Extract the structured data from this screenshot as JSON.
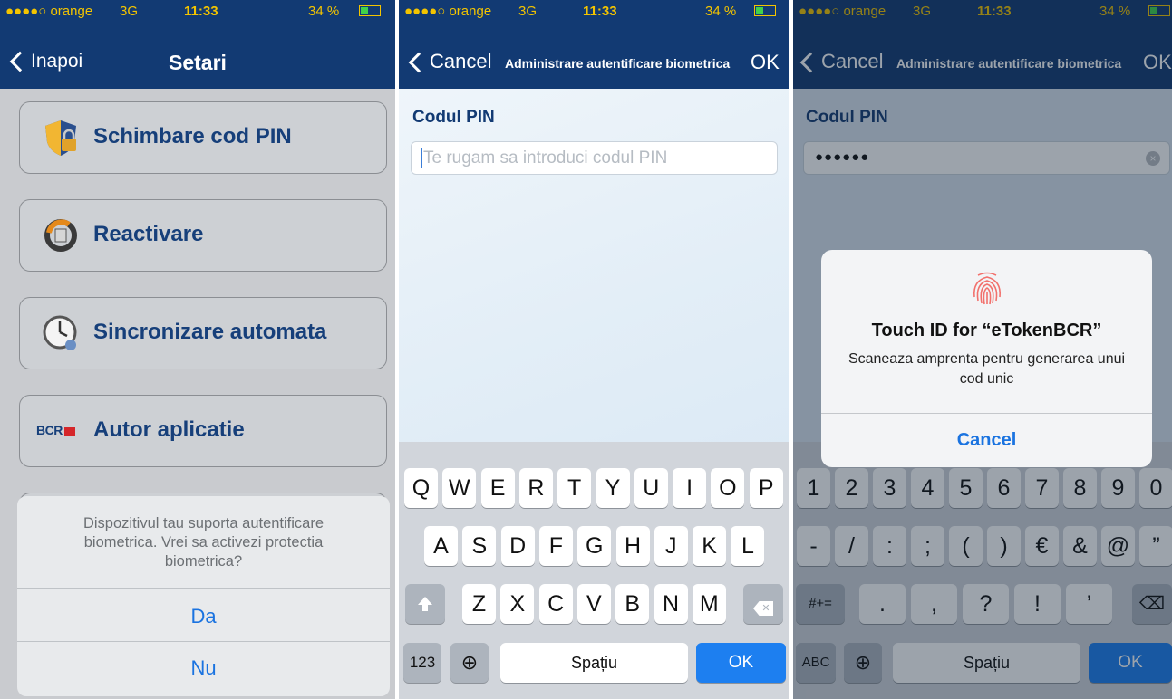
{
  "status": {
    "carrier": "●●●●○ orange",
    "network": "3G",
    "time": "11:33",
    "battery": "34 %"
  },
  "settings": {
    "back_label": "Inapoi",
    "title": "Setari",
    "items": [
      {
        "label": "Schimbare cod PIN"
      },
      {
        "label": "Reactivare"
      },
      {
        "label": "Sincronizare automata"
      },
      {
        "label": "Autor aplicatie"
      }
    ],
    "bcr_logo_text": "BCR",
    "dialog": {
      "message": "Dispozitivul tau suporta autentificare biometrica. Vrei sa activezi protectia biometrica?",
      "yes": "Da",
      "no": "Nu"
    }
  },
  "pin_screen": {
    "cancel_label": "Cancel",
    "title": "Administrare autentificare biometrica",
    "ok_label": "OK",
    "field_label": "Codul PIN",
    "placeholder": "Te rugam sa introduci codul PIN",
    "masked_value": "●●●●●●"
  },
  "keyboard_letters": {
    "row1": [
      "Q",
      "W",
      "E",
      "R",
      "T",
      "Y",
      "U",
      "I",
      "O",
      "P"
    ],
    "row2": [
      "A",
      "S",
      "D",
      "F",
      "G",
      "H",
      "J",
      "K",
      "L"
    ],
    "row3": [
      "Z",
      "X",
      "C",
      "V",
      "B",
      "N",
      "M"
    ],
    "mode_label": "123",
    "space_label": "Spațiu",
    "return_label": "OK"
  },
  "keyboard_numbers": {
    "row1": [
      "1",
      "2",
      "3",
      "4",
      "5",
      "6",
      "7",
      "8",
      "9",
      "0"
    ],
    "row2": [
      "-",
      "/",
      ":",
      ";",
      "(",
      ")",
      "€",
      "&",
      "@",
      "”"
    ],
    "row3": [
      ".",
      ",",
      "?",
      "!",
      "’"
    ],
    "symbols_label": "#+=",
    "mode_label": "ABC",
    "space_label": "Spațiu",
    "return_label": "OK"
  },
  "touchid": {
    "title": "Touch ID for “eTokenBCR”",
    "message": "Scaneaza amprenta pentru generarea unui cod unic",
    "cancel": "Cancel"
  },
  "colors": {
    "nav": "#123a73",
    "accent": "#1a73e0",
    "status_text": "#f3c400"
  }
}
